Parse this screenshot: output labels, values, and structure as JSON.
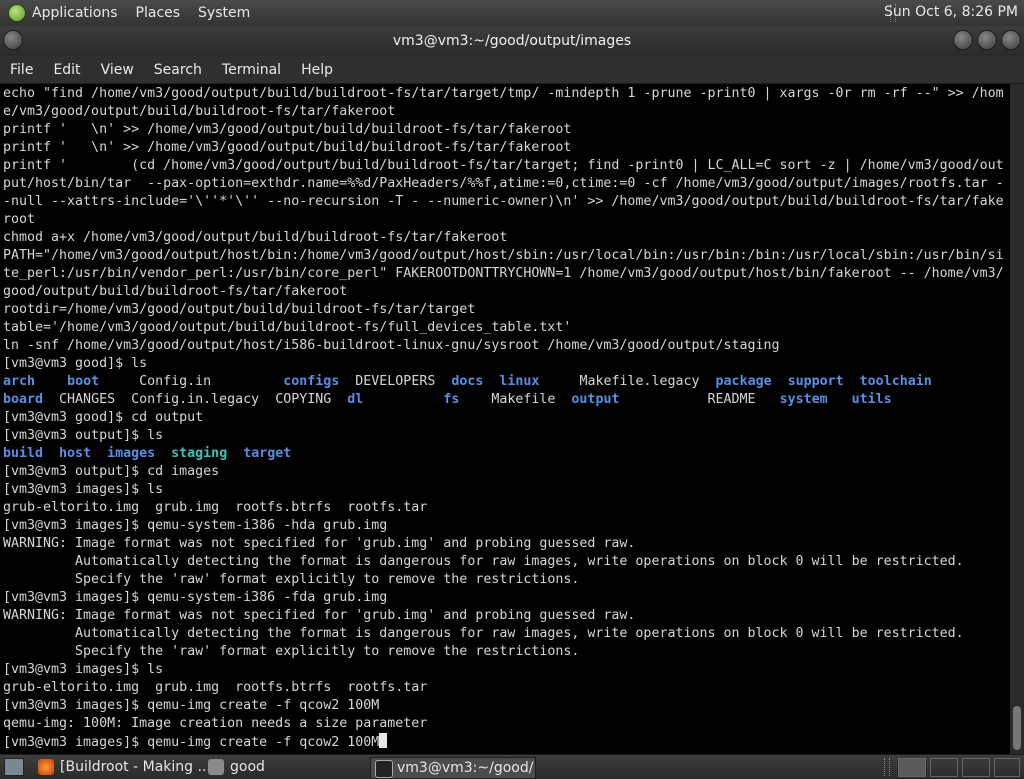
{
  "top_panel": {
    "menus": [
      "Applications",
      "Places",
      "System"
    ],
    "clock": "Sun Oct  6,  8:26 PM"
  },
  "window": {
    "title": "vm3@vm3:~/good/output/images"
  },
  "menubar": [
    "File",
    "Edit",
    "View",
    "Search",
    "Terminal",
    "Help"
  ],
  "terminal": {
    "lines": [
      "echo \"find /home/vm3/good/output/build/buildroot-fs/tar/target/tmp/ -mindepth 1 -prune -print0 | xargs -0r rm -rf --\" >> /hom",
      "e/vm3/good/output/build/buildroot-fs/tar/fakeroot",
      "printf '   \\n' >> /home/vm3/good/output/build/buildroot-fs/tar/fakeroot",
      "printf '   \\n' >> /home/vm3/good/output/build/buildroot-fs/tar/fakeroot",
      "printf '        (cd /home/vm3/good/output/build/buildroot-fs/tar/target; find -print0 | LC_ALL=C sort -z | /home/vm3/good/out",
      "put/host/bin/tar  --pax-option=exthdr.name=%%d/PaxHeaders/%%f,atime:=0,ctime:=0 -cf /home/vm3/good/output/images/rootfs.tar -",
      "-null --xattrs-include='\\''*'\\'' --no-recursion -T - --numeric-owner)\\n' >> /home/vm3/good/output/build/buildroot-fs/tar/fake",
      "root",
      "chmod a+x /home/vm3/good/output/build/buildroot-fs/tar/fakeroot",
      "PATH=\"/home/vm3/good/output/host/bin:/home/vm3/good/output/host/sbin:/usr/local/bin:/usr/bin:/bin:/usr/local/sbin:/usr/bin/si",
      "te_perl:/usr/bin/vendor_perl:/usr/bin/core_perl\" FAKEROOTDONTTRYCHOWN=1 /home/vm3/good/output/host/bin/fakeroot -- /home/vm3/",
      "good/output/build/buildroot-fs/tar/fakeroot",
      "rootdir=/home/vm3/good/output/build/buildroot-fs/tar/target",
      "table='/home/vm3/good/output/build/buildroot-fs/full_devices_table.txt'",
      "ln -snf /home/vm3/good/output/host/i586-buildroot-linux-gnu/sysroot /home/vm3/good/output/staging",
      "[vm3@vm3 good]$ ls"
    ],
    "ls_good": [
      [
        {
          "t": "arch",
          "c": "blue"
        },
        {
          "t": "    "
        },
        {
          "t": "boot",
          "c": "blue"
        },
        {
          "t": "     Config.in         "
        },
        {
          "t": "configs",
          "c": "blue"
        },
        {
          "t": "  DEVELOPERS  "
        },
        {
          "t": "docs",
          "c": "blue"
        },
        {
          "t": "  "
        },
        {
          "t": "linux",
          "c": "blue"
        },
        {
          "t": "     Makefile.legacy  "
        },
        {
          "t": "package",
          "c": "blue"
        },
        {
          "t": "  "
        },
        {
          "t": "support",
          "c": "blue"
        },
        {
          "t": "  "
        },
        {
          "t": "toolchain",
          "c": "blue"
        }
      ],
      [
        {
          "t": "board",
          "c": "blue"
        },
        {
          "t": "  CHANGES  Config.in.legacy  COPYING  "
        },
        {
          "t": "dl",
          "c": "blue"
        },
        {
          "t": "          "
        },
        {
          "t": "fs",
          "c": "blue"
        },
        {
          "t": "    Makefile  "
        },
        {
          "t": "output",
          "c": "blue"
        },
        {
          "t": "           README   "
        },
        {
          "t": "system",
          "c": "blue"
        },
        {
          "t": "   "
        },
        {
          "t": "utils",
          "c": "blue"
        }
      ]
    ],
    "lines_mid": [
      "[vm3@vm3 good]$ cd output",
      "[vm3@vm3 output]$ ls"
    ],
    "ls_output": [
      [
        {
          "t": "build",
          "c": "blue"
        },
        {
          "t": "  "
        },
        {
          "t": "host",
          "c": "blue"
        },
        {
          "t": "  "
        },
        {
          "t": "images",
          "c": "blue"
        },
        {
          "t": "  "
        },
        {
          "t": "staging",
          "c": "teal"
        },
        {
          "t": "  "
        },
        {
          "t": "target",
          "c": "blue"
        }
      ]
    ],
    "lines_end": [
      "[vm3@vm3 output]$ cd images",
      "[vm3@vm3 images]$ ls",
      "grub-eltorito.img  grub.img  rootfs.btrfs  rootfs.tar",
      "[vm3@vm3 images]$ qemu-system-i386 -hda grub.img",
      "WARNING: Image format was not specified for 'grub.img' and probing guessed raw.",
      "         Automatically detecting the format is dangerous for raw images, write operations on block 0 will be restricted.",
      "         Specify the 'raw' format explicitly to remove the restrictions.",
      "[vm3@vm3 images]$ qemu-system-i386 -fda grub.img",
      "WARNING: Image format was not specified for 'grub.img' and probing guessed raw.",
      "         Automatically detecting the format is dangerous for raw images, write operations on block 0 will be restricted.",
      "         Specify the 'raw' format explicitly to remove the restrictions.",
      "[vm3@vm3 images]$ ls",
      "grub-eltorito.img  grub.img  rootfs.btrfs  rootfs.tar",
      "[vm3@vm3 images]$ qemu-img create -f qcow2 100M",
      "qemu-img: 100M: Image creation needs a size parameter"
    ],
    "current_input": "[vm3@vm3 images]$ qemu-img create -f qcow2 100M"
  },
  "taskbar": {
    "tasks": [
      "[Buildroot - Making ...",
      "good",
      "vm3@vm3:~/good/..."
    ]
  }
}
